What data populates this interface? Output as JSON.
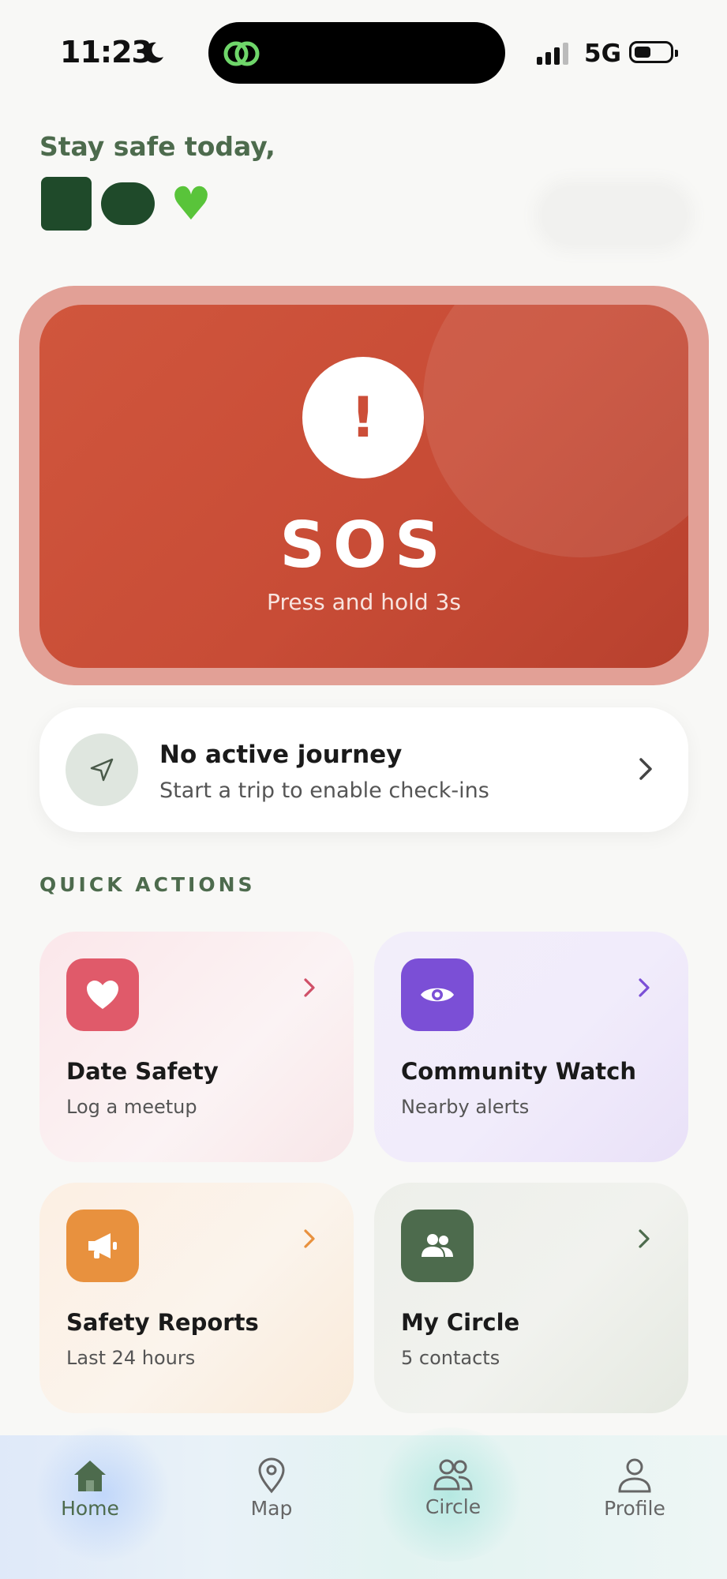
{
  "status_bar": {
    "time": "11:23",
    "network": "5G"
  },
  "greeting": {
    "line": "Stay safe today,"
  },
  "sos": {
    "title": "SOS",
    "subtitle": "Press and hold 3s",
    "icon_glyph": "!"
  },
  "journey": {
    "title": "No active journey",
    "subtitle": "Start a trip to enable check-ins"
  },
  "quick_actions": {
    "heading": "QUICK ACTIONS",
    "items": [
      {
        "title": "Date Safety",
        "subtitle": "Log a meetup",
        "icon": "heart-icon",
        "color": "#e05a6a"
      },
      {
        "title": "Community Watch",
        "subtitle": "Nearby alerts",
        "icon": "eye-icon",
        "color": "#7b4fd6"
      },
      {
        "title": "Safety Reports",
        "subtitle": "Last 24 hours",
        "icon": "megaphone-icon",
        "color": "#e8913e"
      },
      {
        "title": "My Circle",
        "subtitle": "5 contacts",
        "icon": "people-icon",
        "color": "#4d6b4d"
      }
    ]
  },
  "tabbar": {
    "items": [
      {
        "label": "Home",
        "icon": "home-icon",
        "active": true
      },
      {
        "label": "Map",
        "icon": "map-pin-icon",
        "active": false
      },
      {
        "label": "Circle",
        "icon": "people-icon",
        "active": false
      },
      {
        "label": "Profile",
        "icon": "profile-icon",
        "active": false
      }
    ]
  },
  "colors": {
    "sos": "#c84c36",
    "accent": "#4d6b4d",
    "background": "#f8f8f6"
  }
}
